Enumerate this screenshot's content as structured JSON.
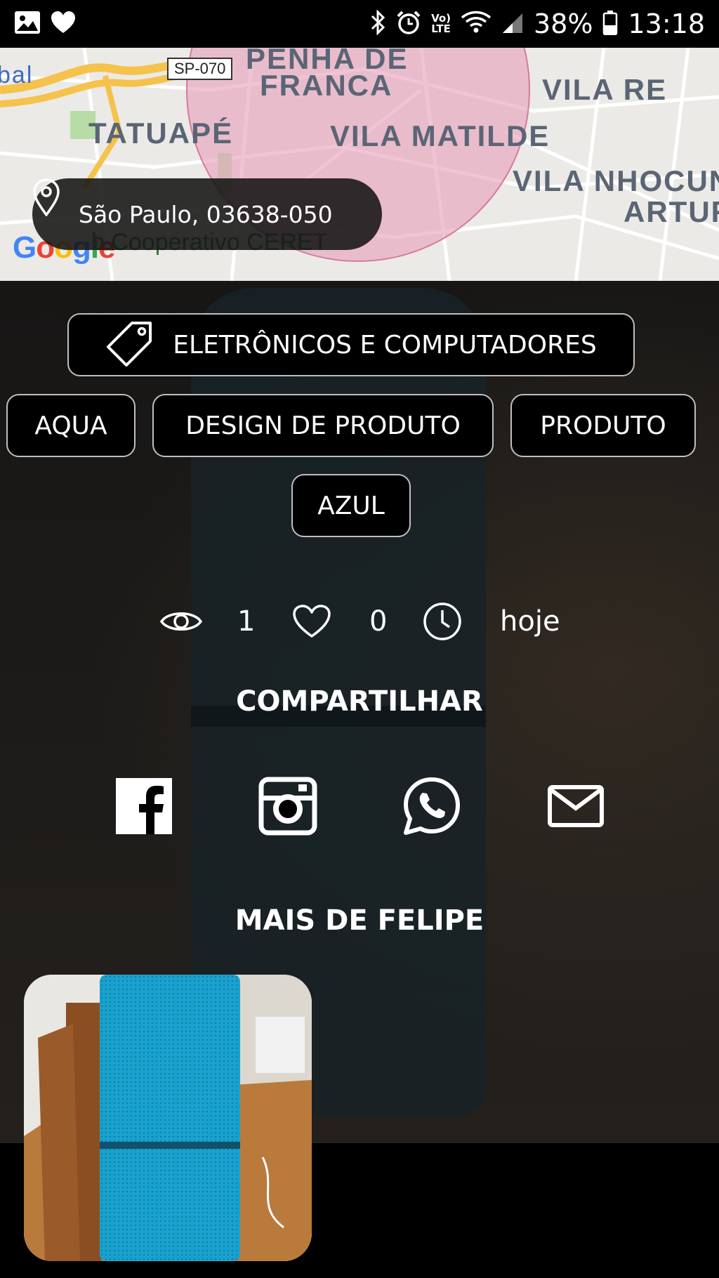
{
  "status_bar": {
    "net_top": "Vo)",
    "net_bottom": "LTE",
    "battery_percent": "38%",
    "time": "13:18",
    "icons": [
      "gallery-icon",
      "heart-icon",
      "bluetooth-icon",
      "alarm-icon",
      "wifi-icon",
      "signal-icon",
      "battery-icon"
    ]
  },
  "map": {
    "labels": {
      "penha": "PENHA DE",
      "franca": "FRANCA",
      "vila_re": "VILA RE",
      "tatuape": "TATUAPÉ",
      "vila_matilde": "VILA MATILDE",
      "vila_nhocune": "VILA NHOCUN",
      "artur": "ARTUR",
      "left_fragment": "bal",
      "road_shield": "SP-070",
      "poi": "b Cooperativo CERET"
    },
    "location_text": "São Paulo, 03638-050",
    "google": "Google"
  },
  "category": {
    "label": "ELETRÔNICOS E COMPUTADORES",
    "icon": "tag-icon"
  },
  "tags": [
    "AQUA",
    "DESIGN DE PRODUTO",
    "PRODUTO",
    "AZUL"
  ],
  "stats": {
    "views": "1",
    "likes": "0",
    "date": "hoje"
  },
  "share": {
    "title": "COMPARTILHAR",
    "icons": [
      "facebook-icon",
      "instagram-icon",
      "whatsapp-icon",
      "mail-icon"
    ]
  },
  "more": {
    "title": "MAIS DE FELIPE"
  },
  "colors": {
    "map_circle": "#e8a3bf",
    "chip_border": "#bfbfbf",
    "background": "#000000"
  }
}
